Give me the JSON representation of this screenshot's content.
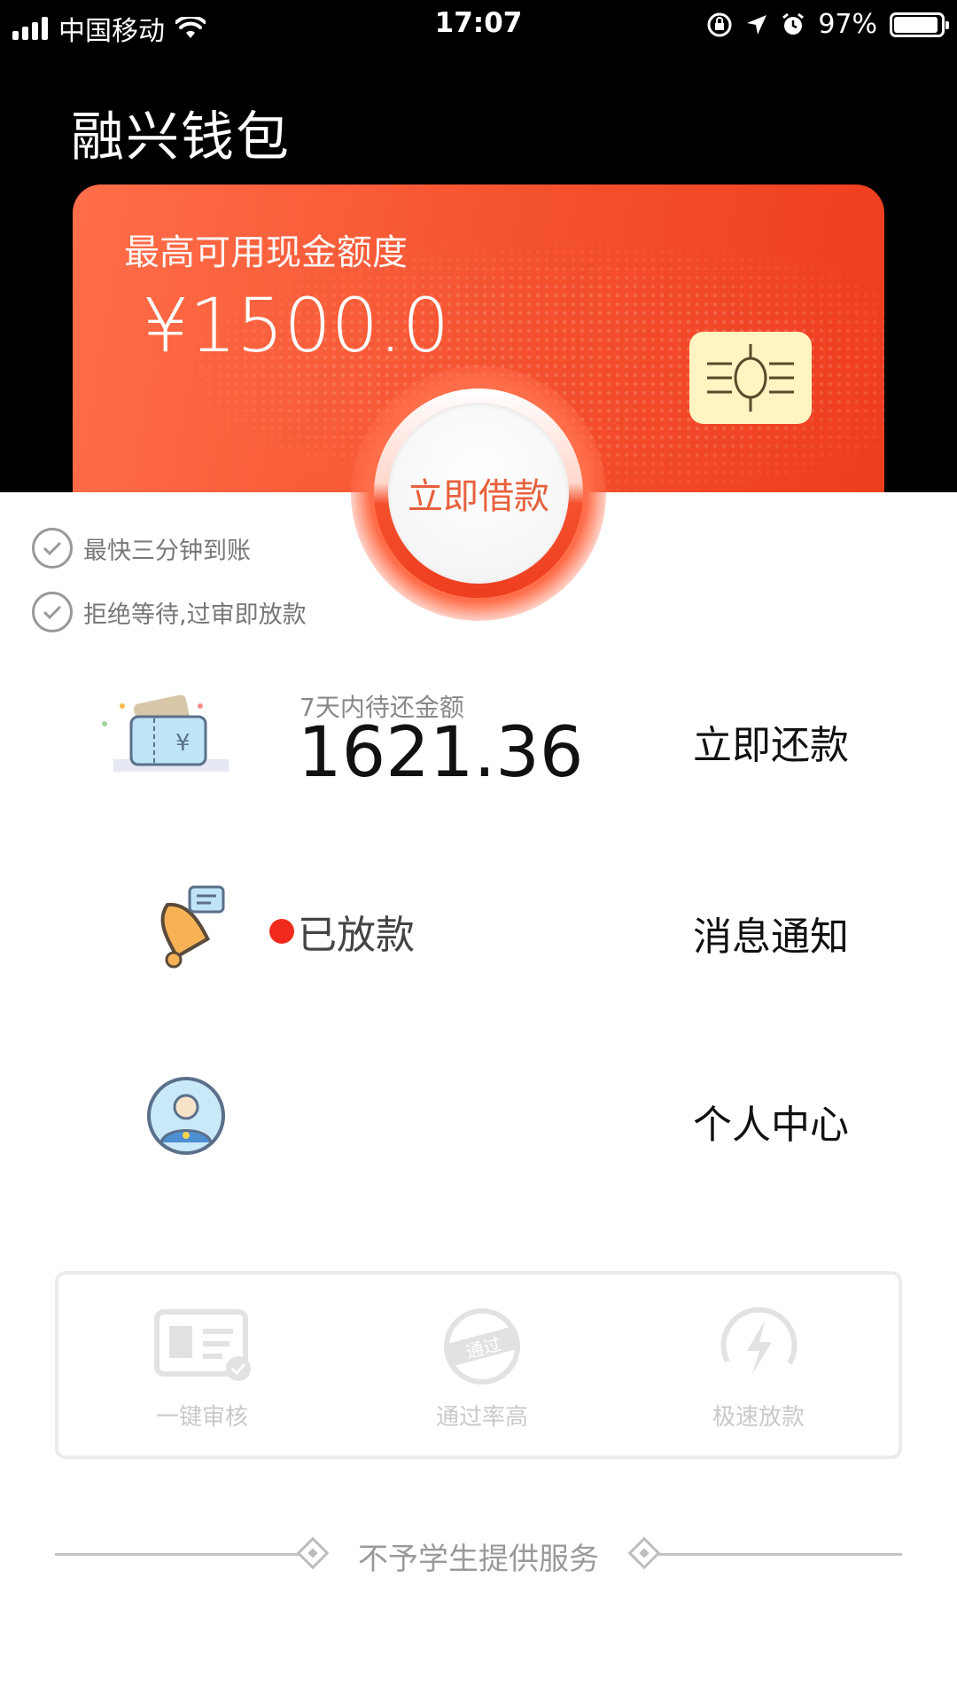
{
  "status_bar": {
    "carrier": "中国移动",
    "time": "17:07",
    "battery": "97%"
  },
  "header": {
    "title": "融兴钱包"
  },
  "card": {
    "label": "最高可用现金额度",
    "amount": "¥1500.0",
    "borrow_button": "立即借款"
  },
  "features_checks": [
    "最快三分钟到账",
    "拒绝等待,过审即放款"
  ],
  "repay_row": {
    "sub_label": "7天内待还金额",
    "amount": "1621.36",
    "action": "立即还款"
  },
  "notice_row": {
    "status": "已放款",
    "action": "消息通知"
  },
  "profile_row": {
    "action": "个人中心"
  },
  "feature_panel": {
    "items": [
      "一键审核",
      "通过率高",
      "极速放款"
    ],
    "stamp_text": "通过"
  },
  "footer": {
    "text": "不予学生提供服务"
  },
  "colors": {
    "accent": "#f4512e",
    "dot_red": "#f02a1c"
  }
}
